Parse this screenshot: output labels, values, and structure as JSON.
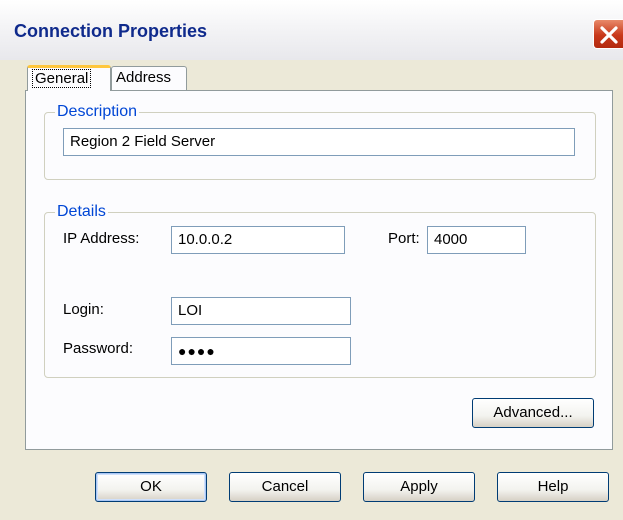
{
  "window": {
    "title": "Connection Properties",
    "close_icon": "close-icon",
    "accent_color": "#C8381A",
    "title_color": "#0F2A8C"
  },
  "tabs": [
    {
      "label": "General",
      "active": true
    },
    {
      "label": "Address",
      "active": false
    }
  ],
  "description": {
    "legend": "Description",
    "value": "Region 2 Field Server"
  },
  "details": {
    "legend": "Details",
    "ip_label": "IP Address:",
    "ip_value": "10.0.0.2",
    "port_label": "Port:",
    "port_value": "4000",
    "login_label": "Login:",
    "login_value": "LOI",
    "password_label": "Password:",
    "password_value": "●●●●"
  },
  "buttons": {
    "advanced": "Advanced...",
    "ok": "OK",
    "cancel": "Cancel",
    "apply": "Apply",
    "help": "Help"
  }
}
